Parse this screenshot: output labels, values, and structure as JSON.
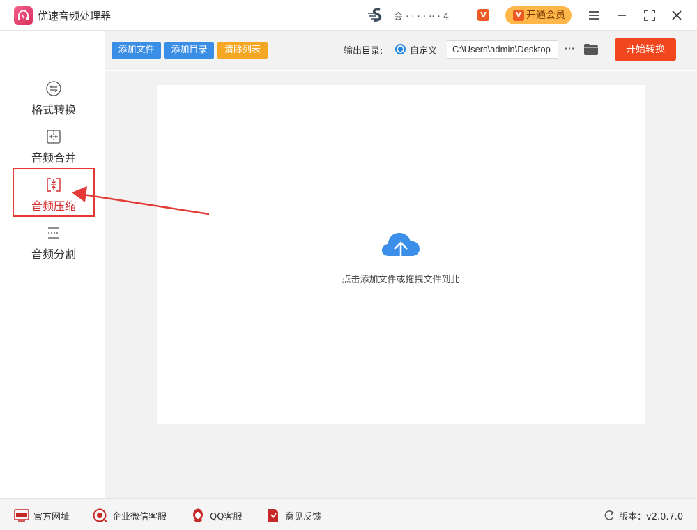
{
  "app": {
    "title": "优速音频处理器"
  },
  "user": {
    "name": "会 · ·  ·  ·  ·· · 4"
  },
  "header": {
    "vip_label": "开通会员",
    "vip_badge": "V"
  },
  "toolbar": {
    "add_file_label": "添加文件",
    "add_dir_label": "添加目录",
    "clear_list_label": "清除列表",
    "output_dir_label": "输出目录:",
    "custom_label": "自定义",
    "output_path": "C:\\Users\\admin\\Desktop",
    "more_label": "···",
    "start_label": "开始转换"
  },
  "sidebar": {
    "items": [
      {
        "label": "格式转换",
        "icon": "format-convert-icon",
        "active": false
      },
      {
        "label": "音频合并",
        "icon": "audio-merge-icon",
        "active": false
      },
      {
        "label": "音频压缩",
        "icon": "audio-compress-icon",
        "active": true
      },
      {
        "label": "音频分割",
        "icon": "audio-split-icon",
        "active": false
      }
    ]
  },
  "main": {
    "drop_hint": "点击添加文件或拖拽文件到此"
  },
  "footer": {
    "website_label": "官方网址",
    "wechat_label": "企业微信客服",
    "qq_label": "QQ客服",
    "feedback_label": "意见反馈",
    "version_label": "版本：v2.0.7.0"
  },
  "colors": {
    "accent_red": "#f1461e",
    "accent_blue": "#3a8ee6",
    "accent_orange": "#f5a623",
    "vip_gold": "#ffb74a",
    "annotation_red": "#e53935"
  }
}
